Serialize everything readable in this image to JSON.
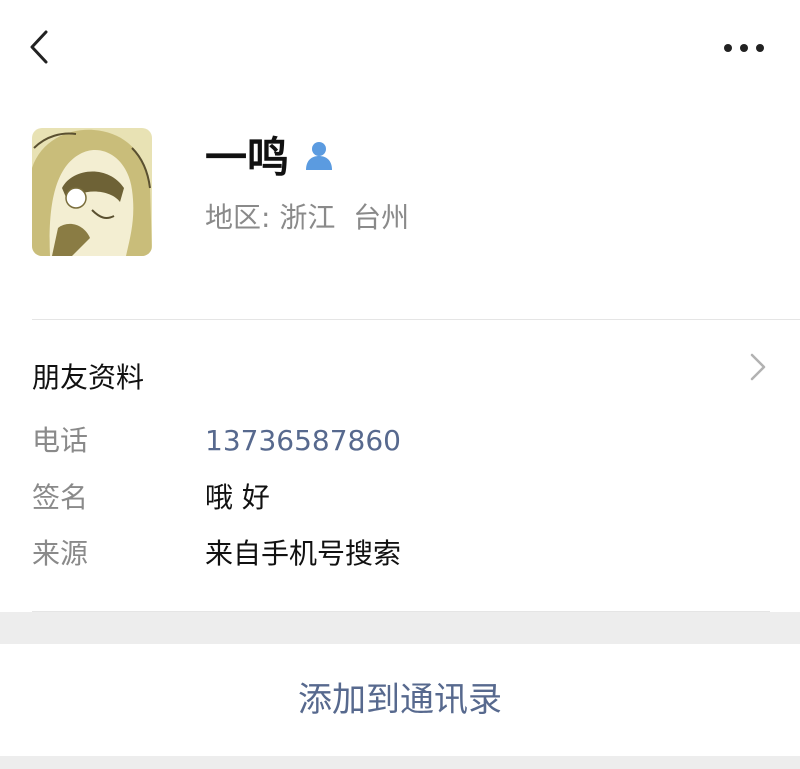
{
  "profile": {
    "name": "一鸣",
    "region": "地区: 浙江  台州"
  },
  "details": {
    "section_title": "朋友资料",
    "rows": [
      {
        "label": "电话",
        "value": "13736587860"
      },
      {
        "label": "签名",
        "value": "哦 好"
      },
      {
        "label": "来源",
        "value": "来自手机号搜索"
      }
    ]
  },
  "actions": {
    "add_to_contacts": "添加到通讯录"
  },
  "icons": {
    "back": "chevron-left-icon",
    "more": "more-dots-icon",
    "user": "person-icon",
    "detail": "chevron-right-icon"
  },
  "colors": {
    "link": "#57698e",
    "secondary_text": "#8a8a8a",
    "background_band": "#ededed",
    "user_icon": "#5b9be0"
  }
}
